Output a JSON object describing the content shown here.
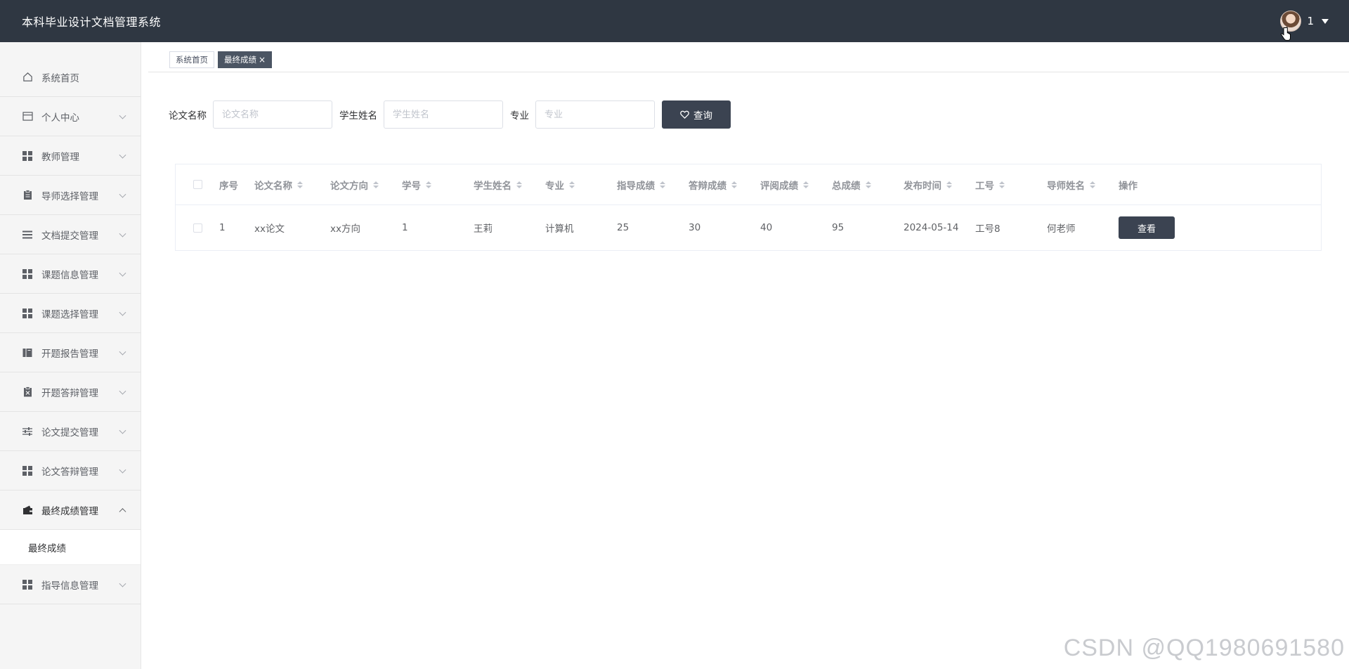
{
  "header": {
    "title": "本科毕业设计文档管理系统",
    "user_name": "1"
  },
  "sidebar": {
    "items": [
      {
        "label": "系统首页",
        "icon": "home-icon",
        "expandable": false
      },
      {
        "label": "个人中心",
        "icon": "card-icon",
        "expandable": true
      },
      {
        "label": "教师管理",
        "icon": "grid-icon",
        "expandable": true
      },
      {
        "label": "导师选择管理",
        "icon": "clipboard-icon",
        "expandable": true
      },
      {
        "label": "文档提交管理",
        "icon": "list-icon",
        "expandable": true
      },
      {
        "label": "课题信息管理",
        "icon": "grid-icon",
        "expandable": true
      },
      {
        "label": "课题选择管理",
        "icon": "grid-icon",
        "expandable": true
      },
      {
        "label": "开题报告管理",
        "icon": "book-icon",
        "expandable": true
      },
      {
        "label": "开题答辩管理",
        "icon": "delete-doc-icon",
        "expandable": true
      },
      {
        "label": "论文提交管理",
        "icon": "sliders-icon",
        "expandable": true
      },
      {
        "label": "论文答辩管理",
        "icon": "grid-icon",
        "expandable": true
      },
      {
        "label": "最终成绩管理",
        "icon": "wallet-icon",
        "expandable": true,
        "expanded": true
      },
      {
        "label": "指导信息管理",
        "icon": "grid-icon",
        "expandable": true
      }
    ],
    "submenu_active": "最终成绩"
  },
  "tags": {
    "home": "系统首页",
    "current": "最终成绩",
    "close": "×"
  },
  "filters": {
    "title_label": "论文名称",
    "title_placeholder": "论文名称",
    "student_label": "学生姓名",
    "student_placeholder": "学生姓名",
    "major_label": "专业",
    "major_placeholder": "专业",
    "search_label": "查询"
  },
  "table": {
    "columns": [
      "序号",
      "论文名称",
      "论文方向",
      "学号",
      "学生姓名",
      "专业",
      "指导成绩",
      "答辩成绩",
      "评阅成绩",
      "总成绩",
      "发布时间",
      "工号",
      "导师姓名",
      "操作"
    ],
    "rows": [
      [
        "1",
        "xx论文",
        "xx方向",
        "1",
        "王莉",
        "计算机",
        "25",
        "30",
        "40",
        "95",
        "2024-05-14",
        "工号8",
        "何老师"
      ]
    ],
    "action_label": "查看"
  },
  "watermark": "CSDN @QQ1980691580"
}
